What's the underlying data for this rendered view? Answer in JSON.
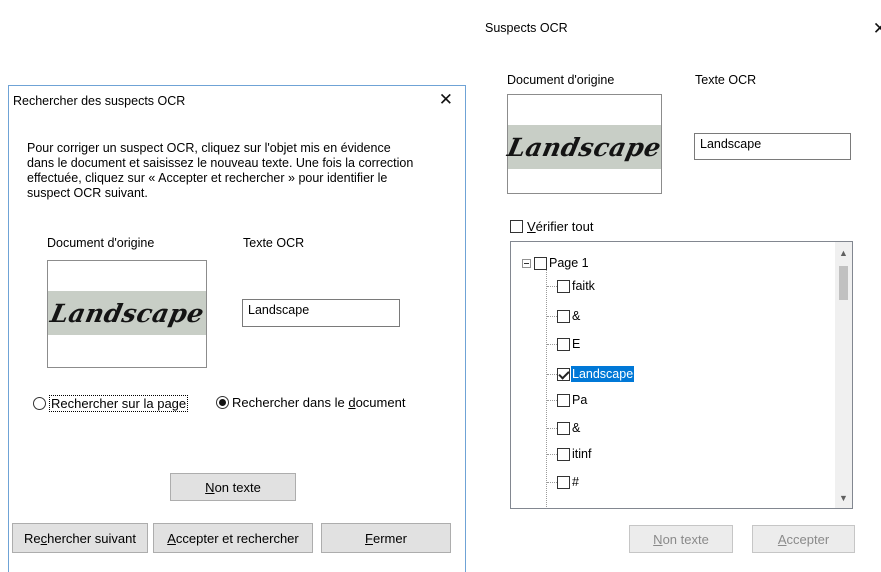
{
  "left_dialog": {
    "title": "Rechercher des suspects OCR",
    "close_glyph": "✕",
    "instructions": "Pour corriger un suspect OCR, cliquez sur l'objet mis en évidence dans le document et saisissez le nouveau texte. Une fois la correction effectuée, cliquez sur « Accepter et rechercher » pour identifier le suspect OCR suivant.",
    "source_label": "Document d'origine",
    "ocr_label": "Texte OCR",
    "image_word": "Landscape",
    "ocr_value": "Landscape",
    "radio_page": {
      "label": "Rechercher sur la page",
      "selected": false
    },
    "radio_document": {
      "before": "Rechercher dans le ",
      "underlined": "d",
      "after": "ocument",
      "selected": true
    },
    "non_text_button": {
      "underlined": "N",
      "after": "on texte"
    },
    "find_next_button": {
      "before": "Re",
      "underlined": "c",
      "after": "hercher suivant"
    },
    "accept_find_button": {
      "underlined": "A",
      "after": "ccepter et rechercher"
    },
    "close_button": {
      "underlined": "F",
      "after": "ermer"
    }
  },
  "right_dialog": {
    "title": "Suspects OCR",
    "close_glyph": "✕",
    "source_label": "Document d'origine",
    "ocr_label": "Texte OCR",
    "image_word": "Landscape",
    "ocr_value": "Landscape",
    "verify_all": {
      "underlined": "V",
      "after": "érifier tout",
      "checked": false
    },
    "tree": {
      "root": {
        "label": "Page 1",
        "checked": false,
        "expanded": true
      },
      "items": [
        {
          "label": "faitk",
          "checked": false,
          "selected": false
        },
        {
          "label": "&",
          "checked": false,
          "selected": false
        },
        {
          "label": "E",
          "checked": false,
          "selected": false
        },
        {
          "label": "Landscape",
          "checked": true,
          "selected": true
        },
        {
          "label": "Pa",
          "checked": false,
          "selected": false
        },
        {
          "label": "&",
          "checked": false,
          "selected": false
        },
        {
          "label": "itinf",
          "checked": false,
          "selected": false
        },
        {
          "label": "#",
          "checked": false,
          "selected": false
        }
      ]
    },
    "scroll_up_glyph": "▲",
    "scroll_down_glyph": "▼",
    "non_text_button": {
      "underlined": "N",
      "after": "on texte",
      "enabled": false
    },
    "accept_button": {
      "underlined": "A",
      "after": "ccepter",
      "enabled": false
    }
  },
  "colors": {
    "selection": "#0078d7",
    "dialog_border": "#6fa3d6",
    "button_face": "#e1e1e1"
  }
}
